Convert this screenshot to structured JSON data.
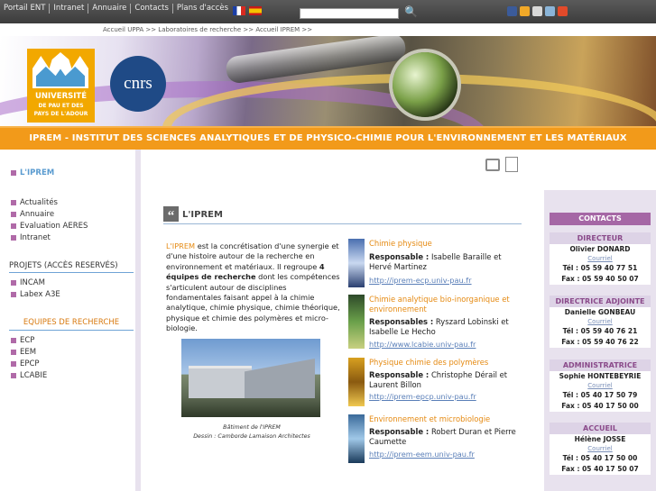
{
  "topnav": [
    "Portail ENT",
    "Intranet",
    "Annuaire",
    "Contacts",
    "Plans d'accès"
  ],
  "search": {
    "placeholder": ""
  },
  "breadcrumb": "Accueil UPPA >> Laboratoires de recherche >> Accueil IPREM >>",
  "logos": {
    "upau": [
      "UNIVERSITÉ",
      "DE PAU ET DES",
      "PAYS DE L'ADOUR"
    ],
    "cnrs": "cnrs"
  },
  "site_title": "IPREM - INSTITUT DES SCIENCES ANALYTIQUES ET DE PHYSICO-CHIMIE POUR L'ENVIRONNEMENT ET LES MATÉRIAUX",
  "sidebar": {
    "current": "L'IPREM",
    "links": [
      "Actualités",
      "Annuaire",
      "Evaluation AERES",
      "Intranet"
    ],
    "projects_heading": "PROJETS (ACCÈS RESERVÉS)",
    "projects": [
      "INCAM",
      "Labex A3E"
    ],
    "teams_heading": "EQUIPES DE RECHERCHE",
    "teams": [
      "ECP",
      "EEM",
      "EPCP",
      "LCABIE"
    ]
  },
  "main": {
    "title": "L'IPREM",
    "intro_lead": "L'IPREM",
    "intro_a": " est la concrétisation d'une synergie et d'une histoire autour de la recherche en environnement et matériaux. Il regroupe ",
    "intro_bold": "4 équipes de recherche",
    "intro_b": " dont les compétences s'articulent autour de disciplines fondamentales faisant appel à la chimie analytique, chimie physique, chimie théorique, physique et chimie des polymères et micro-biologie.",
    "caption_line1": "Bâtiment de l'IPREM",
    "caption_line2": "Dessin : Camborde Lamaison Architectes",
    "teams": [
      {
        "name": "Chimie physique",
        "label": "Responsable :",
        "people": " Isabelle Baraille et Hervé Martinez",
        "url": "http://iprem-ecp.univ-pau.fr"
      },
      {
        "name": "Chimie analytique bio-inorganique et environnement",
        "label": "Responsables :",
        "people": " Ryszard Lobinski et Isabelle Le Hecho",
        "url": "http://www.lcabie.univ-pau.fr"
      },
      {
        "name": "Physique chimie des polymères",
        "label": "Responsable :",
        "people": " Christophe Dérail et Laurent Billon",
        "url": "http://iprem-epcp.univ-pau.fr"
      },
      {
        "name": "Environnement et microbiologie",
        "label": "Responsable :",
        "people": " Robert Duran et Pierre Caumette",
        "url": "http://iprem-eem.univ-pau.fr"
      }
    ]
  },
  "contacts": {
    "heading": "CONTACTS",
    "blocks": [
      {
        "role": "DIRECTEUR",
        "name": "Olivier DONARD",
        "mail": "Courriel",
        "tel": "Tél : 05 59 40 77 51",
        "fax": "Fax : 05 59 40 50 07"
      },
      {
        "role": "DIRECTRICE ADJOINTE",
        "name": "Danielle GONBEAU",
        "mail": "Courriel",
        "tel": "Tél : 05 59 40 76 21",
        "fax": "Fax : 05 59 40 76 22"
      },
      {
        "role": "ADMINISTRATRICE",
        "name": "Sophie HONTEBEYRIE",
        "mail": "Courriel",
        "tel": "Tél : 05 40 17 50 79",
        "fax": "Fax : 05 40 17 50 00"
      },
      {
        "role": "ACCUEIL",
        "name": "Hélène JOSSE",
        "mail": "Courriel",
        "tel": "Tél : 05 40 17 50 00",
        "fax": "Fax : 05 40 17 50 07"
      }
    ]
  },
  "colors": {
    "accent_orange": "#f29a1a",
    "purple": "#a567a5",
    "link_blue": "#5a7fb8"
  },
  "icons": [
    "search-icon",
    "flag-fr-icon",
    "flag-es-icon",
    "facebook-icon",
    "share-icon",
    "print-icon",
    "pdf-icon",
    "quote-icon"
  ]
}
